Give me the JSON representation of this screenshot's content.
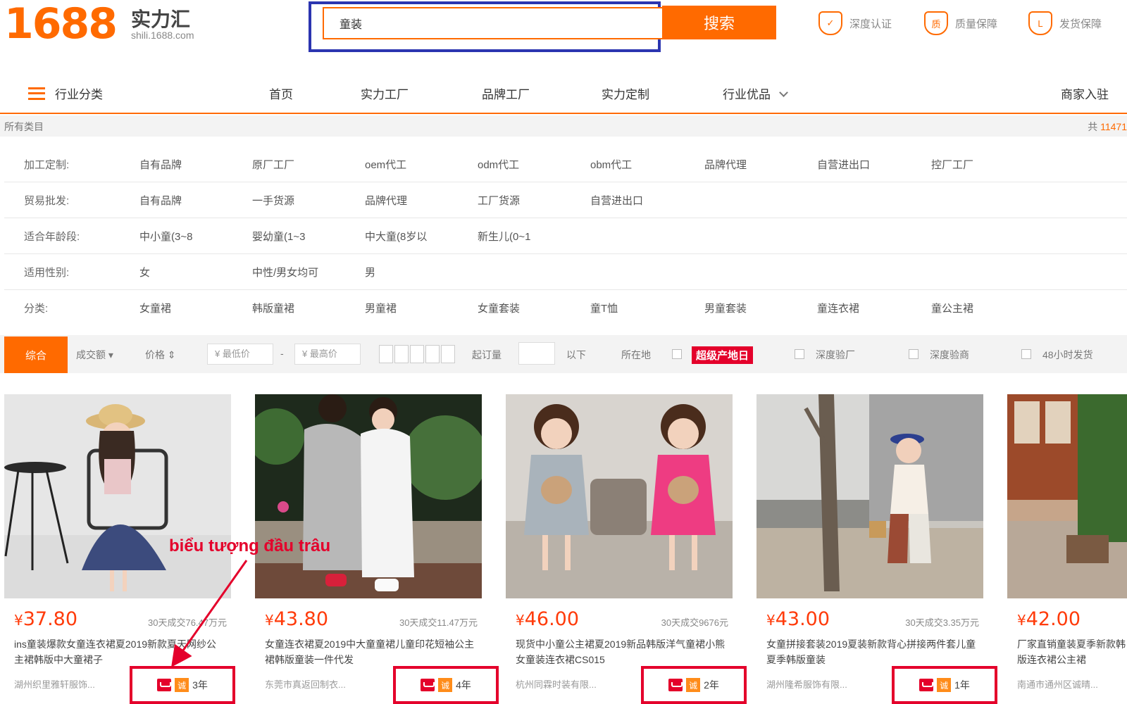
{
  "brand": {
    "logo_number": "1688",
    "name": "实力汇",
    "domain": "shili.1688.com"
  },
  "search": {
    "value": "童装",
    "button_label": "搜索"
  },
  "guarantees": [
    {
      "icon_text": "✓",
      "label": "深度认证"
    },
    {
      "icon_text": "质",
      "label": "质量保障"
    },
    {
      "icon_text": "L",
      "label": "发货保障"
    }
  ],
  "nav": {
    "category_label": "行业分类",
    "links": [
      "首页",
      "实力工厂",
      "品牌工厂",
      "实力定制",
      "行业优品"
    ],
    "right_link": "商家入驻"
  },
  "breadcrumb": {
    "left": "所有类目",
    "right_prefix": "共",
    "right_count": "11471"
  },
  "filters": [
    {
      "label": "加工定制:",
      "options": [
        "自有品牌",
        "原厂工厂",
        "oem代工",
        "odm代工",
        "obm代工",
        "品牌代理",
        "自营进出口",
        "控厂工厂"
      ]
    },
    {
      "label": "贸易批发:",
      "options": [
        "自有品牌",
        "一手货源",
        "品牌代理",
        "工厂货源",
        "自营进出口"
      ]
    },
    {
      "label": "适合年龄段:",
      "options": [
        "中小童(3~8",
        "婴幼童(1~3",
        "中大童(8岁以",
        "新生儿(0~1"
      ]
    },
    {
      "label": "适用性别:",
      "options": [
        "女",
        "中性/男女均可",
        "男"
      ]
    },
    {
      "label": "分类:",
      "options": [
        "女童裙",
        "韩版童裙",
        "男童裙",
        "女童套装",
        "童T恤",
        "男童套装",
        "童连衣裙",
        "童公主裙"
      ]
    }
  ],
  "sort": {
    "active": "综合",
    "sales": "成交额",
    "price": "价格",
    "min_price_placeholder": "¥ 最低价",
    "max_price_placeholder": "¥ 最高价",
    "dash": "-",
    "moq_label": "起订量",
    "moq_suffix": "以下",
    "location_label": "所在地",
    "promo_badge": "超级产地日",
    "checks": [
      "深度验厂",
      "深度验商",
      "48小时发货"
    ]
  },
  "products": [
    {
      "price_symbol": "¥",
      "price": "37.80",
      "sales": "30天成交76.47万元",
      "title": "ins童装爆款女童连衣裙夏2019新款夏天网纱公主裙韩版中大童裙子",
      "shop": "湖州织里雅轩服饰...",
      "years": "3年",
      "badge_icon": "诚"
    },
    {
      "price_symbol": "¥",
      "price": "43.80",
      "sales": "30天成交11.47万元",
      "title": "女童连衣裙夏2019中大童童裙儿童印花短袖公主裙韩版童装一件代发",
      "shop": "东莞市真返回制衣...",
      "years": "4年",
      "badge_icon": "诚"
    },
    {
      "price_symbol": "¥",
      "price": "46.00",
      "sales": "30天成交9676元",
      "title": "现货中小童公主裙夏2019新品韩版洋气童裙小熊女童装连衣裙CS015",
      "shop": "杭州同霖时装有限...",
      "years": "2年",
      "badge_icon": "诚"
    },
    {
      "price_symbol": "¥",
      "price": "43.00",
      "sales": "30天成交3.35万元",
      "title": "女童拼接套装2019夏装新款背心拼接两件套儿童夏季韩版童装",
      "shop": "湖州隆希服饰有限...",
      "years": "1年",
      "badge_icon": "诚"
    },
    {
      "price_symbol": "¥",
      "price": "42.00",
      "sales": "",
      "title": "厂家直销童装夏季新款韩版连衣裙公主裙",
      "shop": "南通市通州区诚晴...",
      "years": "",
      "badge_icon": ""
    }
  ],
  "annotation": {
    "text": "biểu tượng đầu trâu",
    "color": "#e4002b"
  },
  "colors": {
    "accent": "#ff6a00",
    "highlight_box": "#e4002b",
    "search_highlight": "#2b35b0"
  }
}
